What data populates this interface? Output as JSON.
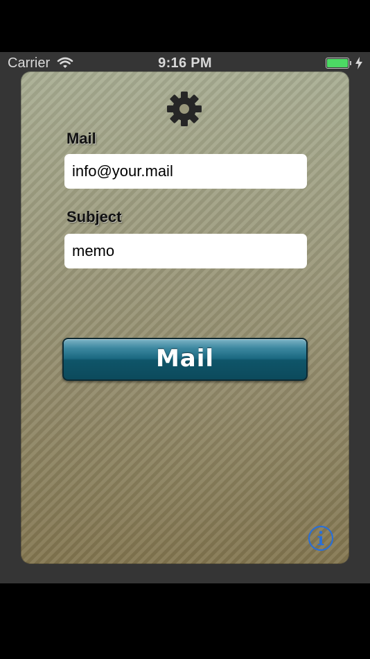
{
  "status_bar": {
    "carrier": "Carrier",
    "time": "9:16 PM",
    "battery_color": "#4cd964"
  },
  "form": {
    "mail_label": "Mail",
    "mail_value": "info@your.mail",
    "subject_label": "Subject",
    "subject_value": "memo"
  },
  "actions": {
    "mail_button_label": "Mail",
    "settings_icon": "gear-icon",
    "info_icon": "info-icon",
    "info_color": "#2a6fd6"
  }
}
